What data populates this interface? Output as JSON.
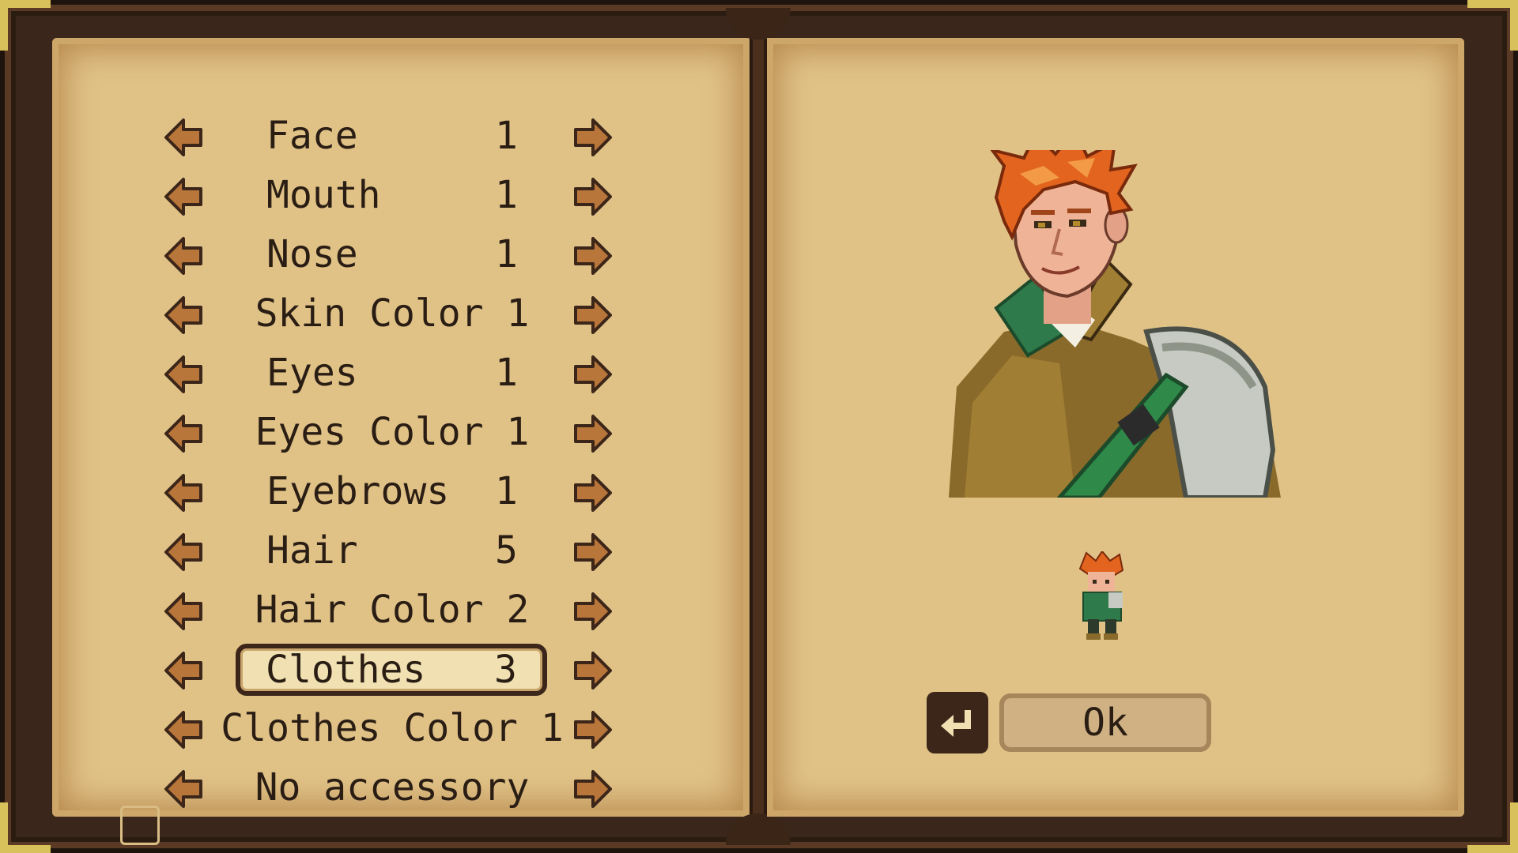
{
  "options": [
    {
      "label": "Face      1"
    },
    {
      "label": "Mouth     1"
    },
    {
      "label": "Nose      1"
    },
    {
      "label": "Skin Color 1"
    },
    {
      "label": "Eyes      1"
    },
    {
      "label": "Eyes Color 1"
    },
    {
      "label": "Eyebrows  1"
    },
    {
      "label": "Hair      5"
    },
    {
      "label": "Hair Color 2"
    },
    {
      "label": "Clothes   3"
    },
    {
      "label": "Clothes Color 1"
    },
    {
      "label": "No accessory"
    }
  ],
  "selected_index": 9,
  "icons": {
    "left": "arrow-left-icon",
    "right": "arrow-right-icon",
    "enter": "enter-key-icon"
  },
  "ok_button": {
    "label": "Ok"
  },
  "colors": {
    "page": "#e0c287",
    "arrow": "#b9763a",
    "selected_bg": "#f1e1b2",
    "frame_trim": "#d8c05a",
    "text": "#2a1d14"
  }
}
